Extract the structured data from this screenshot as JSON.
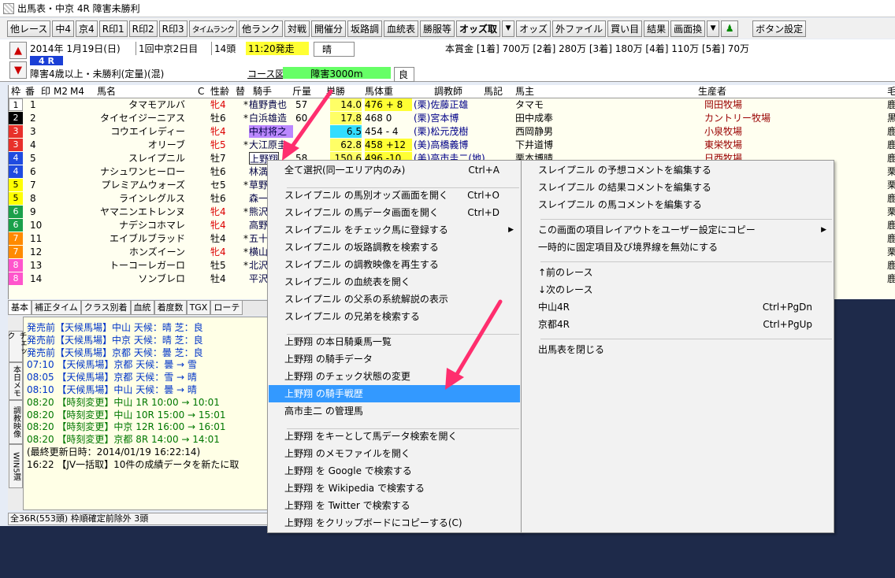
{
  "window": {
    "title": "出馬表・中京 4R 障害未勝利"
  },
  "toolbar": {
    "buttons": [
      "他レース",
      "中4",
      "京4",
      "R印1",
      "R印2",
      "R印3",
      "タイムランク",
      "他ランク",
      "対戦",
      "開催分",
      "坂路調",
      "血統表",
      "勝服等",
      "オッズ取",
      "オッズ",
      "外ファイル",
      "買い目",
      "結果",
      "画面換",
      "ボタン設定"
    ]
  },
  "info": {
    "date": "2014年 1月19日(日)",
    "kaisai": "1回中京2日目",
    "heads": "14頭",
    "post_time": "11:20発走",
    "weather": "晴",
    "race_num": "4 R",
    "condition": "障害4歳以上・未勝利(定量)(混)",
    "course_label": "コース図",
    "course": "障害3000m",
    "going": "良",
    "prize": "本賞金 [1着] 700万 [2着] 280万 [3着] 180万 [4着] 110万 [5着] 70万"
  },
  "table": {
    "headers": [
      "枠",
      "番",
      "印",
      "M2",
      "M4",
      "馬名",
      "C",
      "性齢",
      "替",
      "騎手",
      "斤量",
      "単勝",
      "馬体重",
      "調教師",
      "馬記",
      "馬主",
      "生産者",
      "毛"
    ],
    "rows": [
      {
        "waku": "1",
        "num": "1",
        "name": "タマモアルバ",
        "sex": "牝4",
        "kae": "*",
        "jockey": "植野貴也",
        "kin": "57",
        "odds": "14.0",
        "weight": "476 + 8",
        "trainer": "(栗)佐藤正雄",
        "owner": "タマモ",
        "breeder": "岡田牧場",
        "ke": "鹿"
      },
      {
        "waku": "2",
        "num": "2",
        "name": "タイセイジーニアス",
        "sex": "牡6",
        "kae": "*",
        "jockey": "白浜雄造",
        "kin": "60",
        "odds": "17.8",
        "weight": "468   0",
        "trainer": "(栗)宮本博",
        "owner": "田中成奉",
        "breeder": "カントリー牧場",
        "ke": "黒"
      },
      {
        "waku": "3",
        "num": "3",
        "name": "コウエイレディー",
        "sex": "牝4",
        "kae": "",
        "jockey": "中村将之",
        "kin": "",
        "odds": "6.5",
        "weight": "454 - 4",
        "trainer": "(栗)松元茂樹",
        "owner": "西岡静男",
        "breeder": "小泉牧場",
        "ke": "鹿"
      },
      {
        "waku": "3",
        "num": "4",
        "name": "オリーブ",
        "sex": "牝5",
        "kae": "*",
        "jockey": "大江原圭",
        "kin": "",
        "odds": "62.8",
        "weight": "458 +12",
        "trainer": "(美)高橋義博",
        "owner": "下井道博",
        "breeder": "東栄牧場",
        "ke": "鹿"
      },
      {
        "waku": "4",
        "num": "5",
        "name": "スレイプニル",
        "sex": "牡7",
        "kae": "",
        "jockey": "上野翔",
        "kin": "58",
        "odds": "150.6",
        "weight": "496 -10",
        "trainer": "(美)高市圭二(地)",
        "owner": "栗本博晴",
        "breeder": "日西牧場",
        "ke": "鹿"
      },
      {
        "waku": "4",
        "num": "6",
        "name": "ナシュワンヒーロー",
        "sex": "牡6",
        "kae": "",
        "jockey": "林満明",
        "kin": "",
        "odds": "",
        "weight": "",
        "trainer": "",
        "owner": "",
        "breeder": "",
        "ke": "栗"
      },
      {
        "waku": "5",
        "num": "7",
        "name": "プレミアムウォーズ",
        "sex": "セ5",
        "kae": "*",
        "jockey": "草野太郎",
        "kin": "",
        "odds": "",
        "weight": "",
        "trainer": "",
        "owner": "",
        "breeder": "",
        "ke": "栗"
      },
      {
        "waku": "5",
        "num": "8",
        "name": "ラインレグルス",
        "sex": "牡6",
        "kae": "",
        "jockey": "森一馬",
        "kin": "",
        "odds": "",
        "weight": "",
        "trainer": "",
        "owner": "",
        "breeder": "",
        "ke": "鹿"
      },
      {
        "waku": "6",
        "num": "9",
        "name": "ヤマニンエトレンヌ",
        "sex": "牝4",
        "kae": "*",
        "jockey": "熊沢重文",
        "kin": "",
        "odds": "",
        "weight": "",
        "trainer": "",
        "owner": "",
        "breeder": "",
        "ke": "栗"
      },
      {
        "waku": "6",
        "num": "10",
        "name": "ナデシコホマレ",
        "sex": "牝4",
        "kae": "",
        "jockey": "高野和馬",
        "kin": "",
        "odds": "",
        "weight": "",
        "trainer": "",
        "owner": "",
        "breeder": "",
        "ke": "鹿"
      },
      {
        "waku": "7",
        "num": "11",
        "name": "エイブルブラッド",
        "sex": "牡4",
        "kae": "*",
        "jockey": "五十嵐",
        "kin": "",
        "odds": "",
        "weight": "",
        "trainer": "",
        "owner": "",
        "breeder": "",
        "ke": "鹿"
      },
      {
        "waku": "7",
        "num": "12",
        "name": "ホンズイーン",
        "sex": "牝4",
        "kae": "*",
        "jockey": "横山義行",
        "kin": "",
        "odds": "",
        "weight": "",
        "trainer": "",
        "owner": "",
        "breeder": "",
        "ke": "栗"
      },
      {
        "waku": "8",
        "num": "13",
        "name": "トーコーレガーロ",
        "sex": "牡5",
        "kae": "*",
        "jockey": "北沢伸也",
        "kin": "",
        "odds": "",
        "weight": "",
        "trainer": "",
        "owner": "",
        "breeder": "",
        "ke": "鹿"
      },
      {
        "waku": "8",
        "num": "14",
        "name": "ソンブレロ",
        "sex": "牡4",
        "kae": "",
        "jockey": "平沢健治",
        "kin": "",
        "odds": "",
        "weight": "",
        "trainer": "",
        "owner": "",
        "breeder": "",
        "ke": "鹿"
      }
    ]
  },
  "colors": {
    "waku1": "#ffffff",
    "waku2": "#000000",
    "waku3": "#e8302a",
    "waku4": "#1f4be0",
    "waku5": "#ffff00",
    "waku6": "#1aa04a",
    "waku7": "#ff8a00",
    "waku8": "#ff55cc"
  },
  "tabs": [
    "基本",
    "補正タイム",
    "クラス別着",
    "血統",
    "着度数",
    "TGX",
    "ローテ"
  ],
  "vtabs": [
    "チェック",
    "本日メモ",
    "調教映像",
    "WIN5選"
  ],
  "log": [
    "発売前【天候馬場】中山 天候：晴   芝：良",
    "発売前【天候馬場】中京 天候：晴   芝：良",
    "発売前【天候馬場】京都 天候：曇   芝：良",
    "07:10 【天候馬場】京都 天候：曇 → 雪",
    "08:05 【天候馬場】京都 天候：雪 → 晴",
    "08:10 【天候馬場】中山 天候：曇 → 晴",
    "08:20 【時刻変更】中山  1R 10:00 → 10:01",
    "08:20 【時刻変更】中山 10R 15:00 → 15:01",
    "08:20 【時刻変更】中京 12R 16:00 → 16:01",
    "08:20 【時刻変更】京都  8R 14:00 → 14:01",
    "(最終更新日時：2014/01/19 16:22:14)",
    "16:22 【JV一括取】10件の成績データを新たに取"
  ],
  "status": "全36R(553頭) 枠順確定前除外 3頭",
  "menu1": {
    "items": [
      {
        "label": "全て選択(同一エリア内のみ)",
        "shortcut": "Ctrl+A"
      },
      {
        "label": "スレイプニル の馬別オッズ画面を開く",
        "shortcut": "Ctrl+O"
      },
      {
        "label": "スレイプニル の馬データ画面を開く",
        "shortcut": "Ctrl+D"
      },
      {
        "label": "スレイプニル をチェック馬に登録する",
        "shortcut": ""
      },
      {
        "label": "スレイプニル の坂路調教を検索する",
        "shortcut": ""
      },
      {
        "label": "スレイプニル の調教映像を再生する",
        "shortcut": ""
      },
      {
        "label": "スレイプニル の血統表を開く",
        "shortcut": ""
      },
      {
        "label": "スレイプニル の父系の系統解説の表示",
        "shortcut": ""
      },
      {
        "label": "スレイプニル の兄弟を検索する",
        "shortcut": ""
      },
      {
        "label": "上野翔 の本日騎乗馬一覧",
        "shortcut": ""
      },
      {
        "label": "上野翔 の騎手データ",
        "shortcut": ""
      },
      {
        "label": "上野翔 のチェック状態の変更",
        "shortcut": ""
      },
      {
        "label": "上野翔 の騎手戦歴",
        "shortcut": ""
      },
      {
        "label": "高市圭二 の管理馬",
        "shortcut": ""
      },
      {
        "label": "上野翔 をキーとして馬データ検索を開く",
        "shortcut": ""
      },
      {
        "label": "上野翔 のメモファイルを開く",
        "shortcut": ""
      },
      {
        "label": "上野翔 を Google で検索する",
        "shortcut": ""
      },
      {
        "label": "上野翔 を Wikipedia で検索する",
        "shortcut": ""
      },
      {
        "label": "上野翔 を Twitter で検索する",
        "shortcut": ""
      },
      {
        "label": "上野翔 をクリップボードにコピーする(C)",
        "shortcut": ""
      }
    ]
  },
  "menu2": {
    "items": [
      {
        "label": "スレイプニル の予想コメントを編集する",
        "shortcut": ""
      },
      {
        "label": "スレイプニル の結果コメントを編集する",
        "shortcut": ""
      },
      {
        "label": "スレイプニル の馬コメントを編集する",
        "shortcut": ""
      },
      {
        "label": "この画面の項目レイアウトをユーザー設定にコピー",
        "shortcut": ""
      },
      {
        "label": "一時的に固定項目及び境界線を無効にする",
        "shortcut": ""
      },
      {
        "label": "↑前のレース",
        "shortcut": ""
      },
      {
        "label": "↓次のレース",
        "shortcut": ""
      },
      {
        "label": "中山4R",
        "shortcut": "Ctrl+PgDn"
      },
      {
        "label": "京都4R",
        "shortcut": "Ctrl+PgUp"
      },
      {
        "label": "出馬表を閉じる",
        "shortcut": ""
      }
    ]
  }
}
